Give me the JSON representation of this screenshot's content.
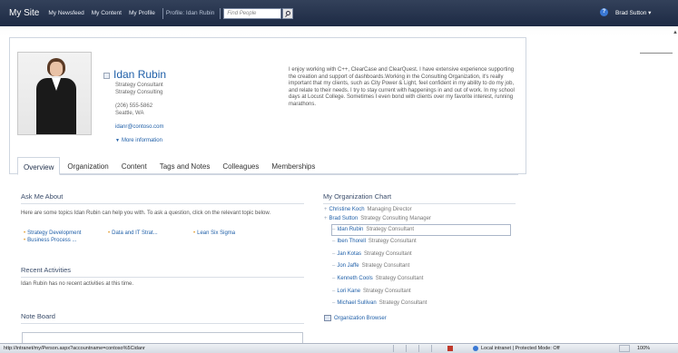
{
  "topbar": {
    "site_title": "My Site",
    "nav": [
      "My Newsfeed",
      "My Content",
      "My Profile"
    ],
    "breadcrumb": "Profile: Idan Rubin",
    "search_placeholder": "Find People",
    "user_menu": "Brad Sutton ▾",
    "help_glyph": "?"
  },
  "profile": {
    "name": "Idan Rubin",
    "title": "Strategy Consultant",
    "department": "Strategy Consulting",
    "phone": "(206) 555-5862",
    "location": "Seattle, WA",
    "email": "idanr@contoso.com",
    "more_info": "More information",
    "about": "I enjoy working with C++, ClearCase and ClearQuest. I have extensive experience supporting the creation and support of dashboards.Working in the Consulting Organization, it's really important that my clients, such as City Power & Light, feel confident in my ability to do my job, and relate to their needs. I try to stay current with happenings in and out of work. In my school days at Locust College. Sometimes I even bond with clients over my favorite interest, running marathons.",
    "tabs": [
      "Overview",
      "Organization",
      "Content",
      "Tags and Notes",
      "Colleagues",
      "Memberships"
    ],
    "active_tab": "Overview"
  },
  "ask_me_about": {
    "title": "Ask Me About",
    "intro": "Here are some topics Idan Rubin can help you with. To ask a question, click on the relevant topic below.",
    "topics": [
      "Strategy Development",
      "Data and IT Strat...",
      "Lean Six Sigma",
      "Business Process ..."
    ]
  },
  "recent_activities": {
    "title": "Recent Activities",
    "text": "Idan Rubin has no recent activities at this time."
  },
  "note_board": {
    "title": "Note Board"
  },
  "org_chart": {
    "title": "My Organization Chart",
    "managers": [
      {
        "name": "Christine Koch",
        "role": "Managing Director"
      },
      {
        "name": "Brad Sutton",
        "role": "Strategy Consulting Manager"
      }
    ],
    "peers": [
      {
        "name": "Idan Rubin",
        "role": "Strategy Consultant"
      },
      {
        "name": "Iben Thorell",
        "role": "Strategy Consultant"
      },
      {
        "name": "Jan Kotas",
        "role": "Strategy Consultant"
      },
      {
        "name": "Jon Jaffe",
        "role": "Strategy Consultant"
      },
      {
        "name": "Kenneth Cools",
        "role": "Strategy Consultant"
      },
      {
        "name": "Lori Kane",
        "role": "Strategy Consultant"
      },
      {
        "name": "Michael Sullivan",
        "role": "Strategy Consultant"
      }
    ],
    "browser_link": "Organization Browser"
  },
  "statusbar": {
    "url": "http://intranet/my/Person.aspx?accountname=contoso%5Cidanr",
    "zone": "Local intranet | Protected Mode: Off",
    "zoom": "100%"
  }
}
